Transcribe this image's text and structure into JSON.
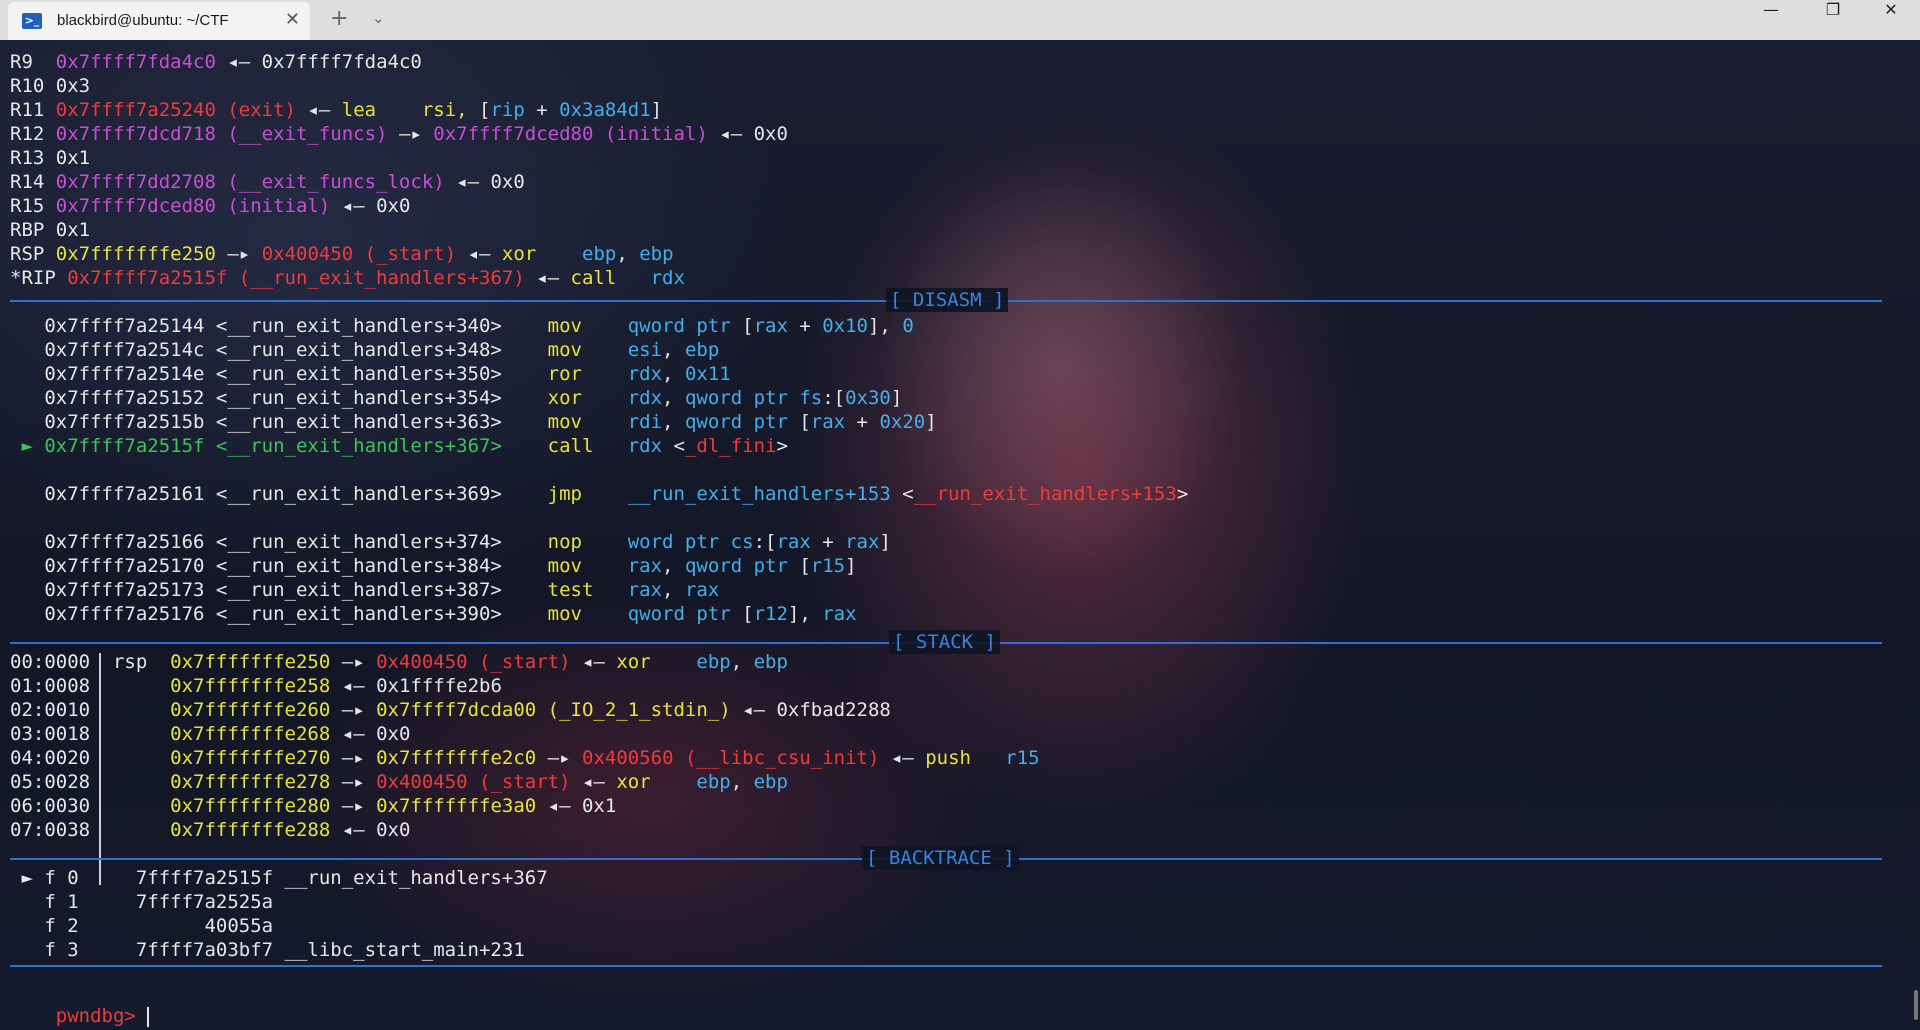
{
  "window": {
    "tab_title": "blackbird@ubuntu: ~/CTF",
    "tab_icon": "terminal-icon",
    "close_tab_glyph": "✕",
    "new_tab_glyph": "+",
    "dropdown_glyph": "⌄",
    "minimize_glyph": "—",
    "restore_glyph": "❐",
    "close_glyph": "✕"
  },
  "colors": {
    "address": "#c84fd3",
    "code": "#ee3b3b",
    "stack": "#e8e23e",
    "register": "#44aee8",
    "current": "#3ec25a",
    "separator": "#2f6fd0"
  },
  "sections": {
    "disasm": "[ DISASM ]",
    "stack": "[ STACK ]",
    "backtrace": "[ BACKTRACE ]"
  },
  "registers": [
    [
      [
        "R9  ",
        "w"
      ],
      [
        "0x7ffff7fda4c0",
        "m"
      ],
      [
        " ◂— 0x7ffff7fda4c0",
        "w"
      ]
    ],
    [
      [
        "R10 ",
        "w"
      ],
      [
        "0x3",
        "w"
      ]
    ],
    [
      [
        "R11 ",
        "w"
      ],
      [
        "0x7ffff7a25240 (exit)",
        "r"
      ],
      [
        " ◂— ",
        "w"
      ],
      [
        "lea    rsi, ",
        "y"
      ],
      [
        "[",
        "w"
      ],
      [
        "rip",
        "c"
      ],
      [
        " + ",
        "w"
      ],
      [
        "0x3a84d1",
        "c"
      ],
      [
        "]",
        "w"
      ]
    ],
    [
      [
        "R12 ",
        "w"
      ],
      [
        "0x7ffff7dcd718 (__exit_funcs)",
        "m"
      ],
      [
        " —▸ ",
        "w"
      ],
      [
        "0x7ffff7dced80 (initial)",
        "m"
      ],
      [
        " ◂— 0x0",
        "w"
      ]
    ],
    [
      [
        "R13 ",
        "w"
      ],
      [
        "0x1",
        "w"
      ]
    ],
    [
      [
        "R14 ",
        "w"
      ],
      [
        "0x7ffff7dd2708 (__exit_funcs_lock)",
        "m"
      ],
      [
        " ◂— 0x0",
        "w"
      ]
    ],
    [
      [
        "R15 ",
        "w"
      ],
      [
        "0x7ffff7dced80 (initial)",
        "m"
      ],
      [
        " ◂— 0x0",
        "w"
      ]
    ],
    [
      [
        "RBP ",
        "w"
      ],
      [
        "0x1",
        "w"
      ]
    ],
    [
      [
        "RSP ",
        "w"
      ],
      [
        "0x7fffffffe250",
        "y"
      ],
      [
        " —▸ ",
        "w"
      ],
      [
        "0x400450 (_start)",
        "r"
      ],
      [
        " ◂— ",
        "w"
      ],
      [
        "xor    ",
        "y"
      ],
      [
        "ebp",
        "c"
      ],
      [
        ", ",
        "w"
      ],
      [
        "ebp",
        "c"
      ]
    ],
    [
      [
        "*RIP ",
        "w"
      ],
      [
        "0x7ffff7a2515f (__run_exit_handlers+367)",
        "r"
      ],
      [
        " ◂— ",
        "w"
      ],
      [
        "call   ",
        "y"
      ],
      [
        "rdx",
        "c"
      ]
    ]
  ],
  "disasm": [
    [
      [
        "   0x7ffff7a25144 <__run_exit_handlers+340>    ",
        "w"
      ],
      [
        "mov    ",
        "y"
      ],
      [
        "qword ptr ",
        "c"
      ],
      [
        "[",
        "w"
      ],
      [
        "rax",
        "c"
      ],
      [
        " + ",
        "w"
      ],
      [
        "0x10",
        "c"
      ],
      [
        "], ",
        "w"
      ],
      [
        "0",
        "c"
      ]
    ],
    [
      [
        "   0x7ffff7a2514c <__run_exit_handlers+348>    ",
        "w"
      ],
      [
        "mov    ",
        "y"
      ],
      [
        "esi",
        "c"
      ],
      [
        ", ",
        "w"
      ],
      [
        "ebp",
        "c"
      ]
    ],
    [
      [
        "   0x7ffff7a2514e <__run_exit_handlers+350>    ",
        "w"
      ],
      [
        "ror    ",
        "y"
      ],
      [
        "rdx",
        "c"
      ],
      [
        ", ",
        "w"
      ],
      [
        "0x11",
        "c"
      ]
    ],
    [
      [
        "   0x7ffff7a25152 <__run_exit_handlers+354>    ",
        "w"
      ],
      [
        "xor    ",
        "y"
      ],
      [
        "rdx",
        "c"
      ],
      [
        ", ",
        "w"
      ],
      [
        "qword ptr ",
        "c"
      ],
      [
        "fs",
        "c"
      ],
      [
        ":[",
        "w"
      ],
      [
        "0x30",
        "c"
      ],
      [
        "]",
        "w"
      ]
    ],
    [
      [
        "   0x7ffff7a2515b <__run_exit_handlers+363>    ",
        "w"
      ],
      [
        "mov    ",
        "y"
      ],
      [
        "rdi",
        "c"
      ],
      [
        ", ",
        "w"
      ],
      [
        "qword ptr ",
        "c"
      ],
      [
        "[",
        "w"
      ],
      [
        "rax",
        "c"
      ],
      [
        " + ",
        "w"
      ],
      [
        "0x20",
        "c"
      ],
      [
        "]",
        "w"
      ]
    ],
    [
      [
        " ► ",
        "g"
      ],
      [
        "0x7ffff7a2515f <__run_exit_handlers+367>    ",
        "g"
      ],
      [
        "call   ",
        "y"
      ],
      [
        "rdx",
        "c"
      ],
      [
        " <",
        "w"
      ],
      [
        "_dl_fini",
        "r"
      ],
      [
        ">",
        "w"
      ]
    ],
    [],
    [
      [
        "   0x7ffff7a25161 <__run_exit_handlers+369>    ",
        "w"
      ],
      [
        "jmp    ",
        "y"
      ],
      [
        "__run_exit_handlers+153",
        "c"
      ],
      [
        " <",
        "w"
      ],
      [
        "__run_exit_handlers+153",
        "r"
      ],
      [
        ">",
        "w"
      ]
    ],
    [],
    [
      [
        "   0x7ffff7a25166 <__run_exit_handlers+374>    ",
        "w"
      ],
      [
        "nop    ",
        "y"
      ],
      [
        "word ptr ",
        "c"
      ],
      [
        "cs",
        "c"
      ],
      [
        ":[",
        "w"
      ],
      [
        "rax",
        "c"
      ],
      [
        " + ",
        "w"
      ],
      [
        "rax",
        "c"
      ],
      [
        "]",
        "w"
      ]
    ],
    [
      [
        "   0x7ffff7a25170 <__run_exit_handlers+384>    ",
        "w"
      ],
      [
        "mov    ",
        "y"
      ],
      [
        "rax",
        "c"
      ],
      [
        ", ",
        "w"
      ],
      [
        "qword ptr ",
        "c"
      ],
      [
        "[",
        "w"
      ],
      [
        "r15",
        "c"
      ],
      [
        "]",
        "w"
      ]
    ],
    [
      [
        "   0x7ffff7a25173 <__run_exit_handlers+387>    ",
        "w"
      ],
      [
        "test   ",
        "y"
      ],
      [
        "rax",
        "c"
      ],
      [
        ", ",
        "w"
      ],
      [
        "rax",
        "c"
      ]
    ],
    [
      [
        "   0x7ffff7a25176 <__run_exit_handlers+390>    ",
        "w"
      ],
      [
        "mov    ",
        "y"
      ],
      [
        "qword ptr ",
        "c"
      ],
      [
        "[",
        "w"
      ],
      [
        "r12",
        "c"
      ],
      [
        "], ",
        "w"
      ],
      [
        "rax",
        "c"
      ]
    ]
  ],
  "stack": [
    [
      [
        "00:0000  ",
        "w"
      ],
      [
        "rsp  ",
        "w"
      ],
      [
        "0x7fffffffe250",
        "y"
      ],
      [
        " —▸ ",
        "w"
      ],
      [
        "0x400450 (_start)",
        "r"
      ],
      [
        " ◂— ",
        "w"
      ],
      [
        "xor    ",
        "y"
      ],
      [
        "ebp",
        "c"
      ],
      [
        ", ",
        "w"
      ],
      [
        "ebp",
        "c"
      ]
    ],
    [
      [
        "01:0008       ",
        "w"
      ],
      [
        "0x7fffffffe258",
        "y"
      ],
      [
        " ◂— 0x1ffffe2b6",
        "w"
      ]
    ],
    [
      [
        "02:0010       ",
        "w"
      ],
      [
        "0x7fffffffe260",
        "y"
      ],
      [
        " —▸ ",
        "w"
      ],
      [
        "0x7ffff7dcda00 (_IO_2_1_stdin_)",
        "y"
      ],
      [
        " ◂— 0xfbad2288",
        "w"
      ]
    ],
    [
      [
        "03:0018       ",
        "w"
      ],
      [
        "0x7fffffffe268",
        "y"
      ],
      [
        " ◂— 0x0",
        "w"
      ]
    ],
    [
      [
        "04:0020       ",
        "w"
      ],
      [
        "0x7fffffffe270",
        "y"
      ],
      [
        " —▸ ",
        "w"
      ],
      [
        "0x7fffffffe2c0",
        "y"
      ],
      [
        " —▸ ",
        "w"
      ],
      [
        "0x400560 (__libc_csu_init)",
        "r"
      ],
      [
        " ◂— ",
        "w"
      ],
      [
        "push   ",
        "y"
      ],
      [
        "r15",
        "c"
      ]
    ],
    [
      [
        "05:0028       ",
        "w"
      ],
      [
        "0x7fffffffe278",
        "y"
      ],
      [
        " —▸ ",
        "w"
      ],
      [
        "0x400450 (_start)",
        "r"
      ],
      [
        " ◂— ",
        "w"
      ],
      [
        "xor    ",
        "y"
      ],
      [
        "ebp",
        "c"
      ],
      [
        ", ",
        "w"
      ],
      [
        "ebp",
        "c"
      ]
    ],
    [
      [
        "06:0030       ",
        "w"
      ],
      [
        "0x7fffffffe280",
        "y"
      ],
      [
        " —▸ ",
        "w"
      ],
      [
        "0x7fffffffe3a0",
        "y"
      ],
      [
        " ◂— 0x1",
        "w"
      ]
    ],
    [
      [
        "07:0038       ",
        "w"
      ],
      [
        "0x7fffffffe288",
        "y"
      ],
      [
        " ◂— 0x0",
        "w"
      ]
    ]
  ],
  "backtrace": [
    [
      [
        " ► f 0     7ffff7a2515f __run_exit_handlers+367",
        "w"
      ]
    ],
    [
      [
        "   f 1     7ffff7a2525a",
        "w"
      ]
    ],
    [
      [
        "   f 2           40055a",
        "w"
      ]
    ],
    [
      [
        "   f 3     7ffff7a03bf7 __libc_start_main+231",
        "w"
      ]
    ]
  ],
  "prompt": {
    "text": "pwndbg> "
  }
}
